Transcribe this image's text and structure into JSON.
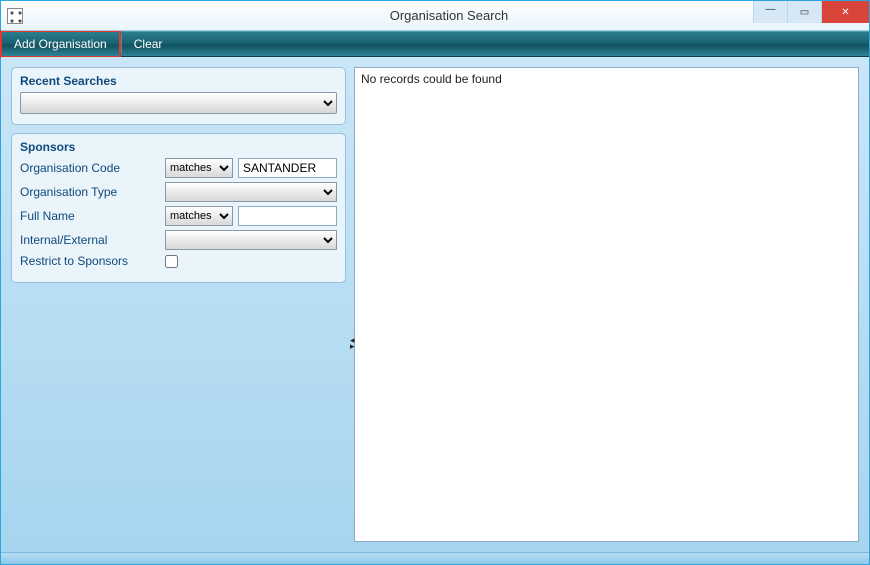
{
  "window": {
    "title": "Organisation Search"
  },
  "toolbar": {
    "add_label": "Add Organisation",
    "clear_label": "Clear"
  },
  "recent_searches": {
    "title": "Recent Searches",
    "selected": ""
  },
  "sponsors": {
    "title": "Sponsors",
    "org_code": {
      "label": "Organisation Code",
      "op": "matches",
      "value": "SANTANDER"
    },
    "org_type": {
      "label": "Organisation Type",
      "value": ""
    },
    "full_name": {
      "label": "Full Name",
      "op": "matches",
      "value": ""
    },
    "int_ext": {
      "label": "Internal/External",
      "value": ""
    },
    "restrict": {
      "label": "Restrict to Sponsors",
      "checked": false
    }
  },
  "operators": [
    "matches"
  ],
  "results": {
    "message": "No records could be found"
  }
}
